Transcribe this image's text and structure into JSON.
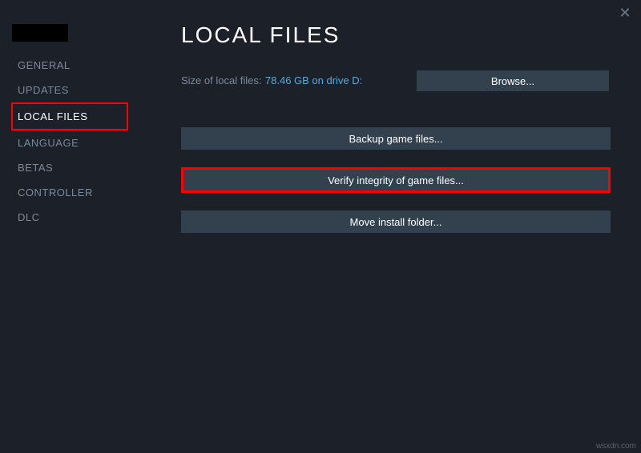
{
  "sidebar": {
    "items": [
      {
        "label": "GENERAL"
      },
      {
        "label": "UPDATES"
      },
      {
        "label": "LOCAL FILES"
      },
      {
        "label": "LANGUAGE"
      },
      {
        "label": "BETAS"
      },
      {
        "label": "CONTROLLER"
      },
      {
        "label": "DLC"
      }
    ]
  },
  "header": {
    "title": "LOCAL FILES"
  },
  "sizeInfo": {
    "label": "Size of local files:",
    "value": "78.46 GB on drive D:"
  },
  "buttons": {
    "browse": "Browse...",
    "backup": "Backup game files...",
    "verify": "Verify integrity of game files...",
    "move": "Move install folder..."
  },
  "watermark": "wsxdn.com"
}
